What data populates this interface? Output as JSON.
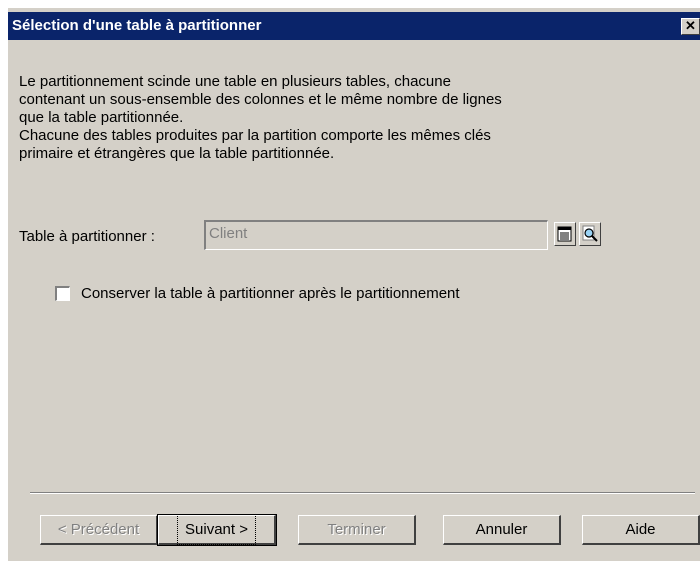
{
  "window": {
    "title": "Sélection d'une table à partitionner",
    "close_glyph": "✕"
  },
  "description": {
    "lines": [
      "Le partitionnement scinde une table en plusieurs tables, chacune",
      "contenant un sous-ensemble des colonnes et le même nombre de lignes",
      "que la table partitionnée.",
      "Chacune des tables produites par la partition comporte les mêmes clés",
      "primaire et étrangères que la table partitionnée."
    ]
  },
  "table_field": {
    "label": "Table à partitionner :",
    "value": "Client",
    "select_icon": "object-list-icon",
    "properties_icon": "magnifier-properties-icon"
  },
  "keep_table": {
    "label": "Conserver la table à partitionner après le partitionnement",
    "checked": false
  },
  "buttons": {
    "previous": "< Précédent",
    "next": "Suivant >",
    "finish": "Terminer",
    "cancel": "Annuler",
    "help": "Aide"
  }
}
